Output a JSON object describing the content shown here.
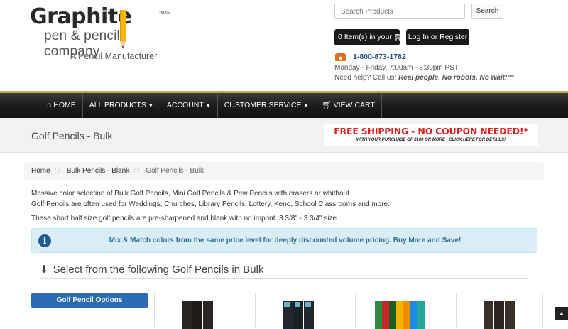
{
  "header": {
    "logo_word": "Graphite",
    "logo_tm": "TM/SM",
    "logo_sub": "pen & pencil company",
    "logo_tag": "A Pencil Manufacturer",
    "search_placeholder": "Search Products",
    "search_button": "Search",
    "cart_button": "0 Item(s) in your",
    "login_button": "Log In or Register",
    "phone": "1-800-873-1782",
    "hours": "Monday - Friday, 7:00am - 3:30pm PST",
    "help_prefix": "Need help? Call us!",
    "help_emphasis": "Real people. No robots. No wait!™"
  },
  "nav": {
    "items": [
      {
        "label": "HOME",
        "icon": "home-icon"
      },
      {
        "label": "ALL PRODUCTS",
        "caret": true
      },
      {
        "label": "ACCOUNT",
        "caret": true
      },
      {
        "label": "CUSTOMER SERVICE",
        "caret": true
      },
      {
        "label": "VIEW CART",
        "icon": "cart-icon"
      }
    ]
  },
  "page": {
    "title": "Golf Pencils - Bulk",
    "banner_main": "FREE SHIPPING - NO COUPON NEEDED!*",
    "banner_sub": "WITH YOUR PURCHASE OF $100 OR MORE - CLICK HERE FOR DETAILS!"
  },
  "breadcrumb": {
    "items": [
      "Home",
      "Bulk Pencils - Blank",
      "Golf Pencils - Bulk"
    ]
  },
  "content": {
    "desc1": "Massive color selection of Bulk Golf Pencils, Mini Golf Pencils & Pew Pencils with erasers or whithout.",
    "desc2": "Golf Pencils are often used for Weddings, Churches, Library Pencils, Lottery, Keno, School Classrooms and more.",
    "desc3": "These short half size golf pencils are pre-sharpened and blank with no imprint. 3 3/8\" - 3 3/4\" size.",
    "info": "Mix & Match colors from the same price level for deeply discounted volume pricing. Buy More and Save!",
    "section_title": "Select from the following Golf Pencils in Bulk",
    "options_button": "Golf Pencil Options"
  },
  "colors": {
    "accent_gold": "#c9a645",
    "link_blue": "#1d4f86",
    "button_blue": "#2a6bb3",
    "banner_red": "#e02020"
  }
}
